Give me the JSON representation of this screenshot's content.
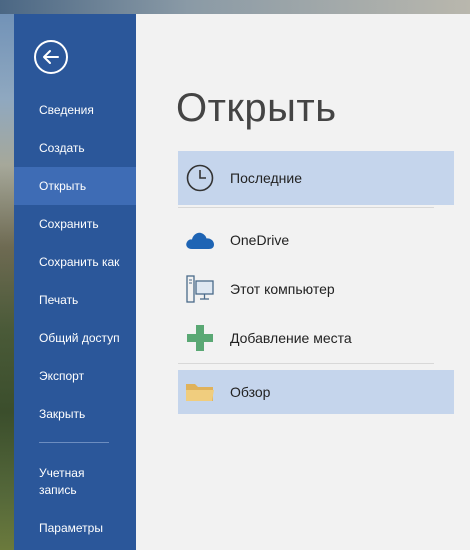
{
  "backstage": {
    "title": "Открыть",
    "nav": [
      {
        "id": "info",
        "label": "Сведения"
      },
      {
        "id": "new",
        "label": "Создать"
      },
      {
        "id": "open",
        "label": "Открыть",
        "active": true
      },
      {
        "id": "save",
        "label": "Сохранить"
      },
      {
        "id": "save-as",
        "label": "Сохранить как"
      },
      {
        "id": "print",
        "label": "Печать"
      },
      {
        "id": "share",
        "label": "Общий доступ"
      },
      {
        "id": "export",
        "label": "Экспорт"
      },
      {
        "id": "close",
        "label": "Закрыть"
      }
    ],
    "nav_bottom": [
      {
        "id": "account",
        "label_line1": "Учетная",
        "label_line2": "запись"
      },
      {
        "id": "options",
        "label": "Параметры"
      }
    ],
    "places": [
      {
        "id": "recent",
        "label": "Последние",
        "icon": "clock-icon",
        "selected": true
      },
      {
        "id": "onedrive",
        "label": "OneDrive",
        "icon": "onedrive-cloud-icon"
      },
      {
        "id": "computer",
        "label": "Этот компьютер",
        "icon": "computer-icon"
      },
      {
        "id": "add-place",
        "label": "Добавление места",
        "icon": "plus-icon"
      },
      {
        "id": "browse",
        "label": "Обзор",
        "icon": "folder-icon",
        "selected": true
      }
    ]
  },
  "colors": {
    "sidebar": "#2b579a",
    "sidebar_active": "#3e6cb5",
    "selected_place": "#c5d5ec",
    "onedrive": "#1e64b4",
    "plus": "#5aa874",
    "folder": "#e8c06a"
  }
}
